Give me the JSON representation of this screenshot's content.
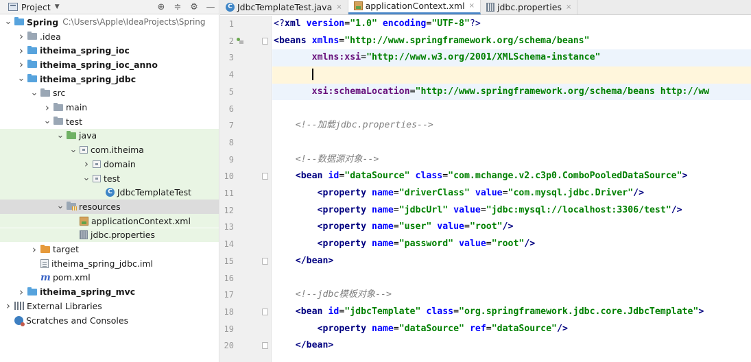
{
  "project_panel": {
    "title": "Project",
    "tree": [
      {
        "label": "Spring",
        "path": "C:\\Users\\Apple\\IdeaProjects\\Spring",
        "bold": true,
        "indent": 0,
        "arrow": "down",
        "icon": "folder-blue"
      },
      {
        "label": ".idea",
        "bold": false,
        "indent": 1,
        "arrow": "right",
        "icon": "folder-gray"
      },
      {
        "label": "itheima_spring_ioc",
        "bold": true,
        "indent": 1,
        "arrow": "right",
        "icon": "folder-blue"
      },
      {
        "label": "itheima_spring_ioc_anno",
        "bold": true,
        "indent": 1,
        "arrow": "right",
        "icon": "folder-blue"
      },
      {
        "label": "itheima_spring_jdbc",
        "bold": true,
        "indent": 1,
        "arrow": "down",
        "icon": "folder-blue"
      },
      {
        "label": "src",
        "bold": false,
        "indent": 2,
        "arrow": "down",
        "icon": "folder-gray"
      },
      {
        "label": "main",
        "bold": false,
        "indent": 3,
        "arrow": "right",
        "icon": "folder-gray"
      },
      {
        "label": "test",
        "bold": false,
        "indent": 3,
        "arrow": "down",
        "icon": "folder-gray"
      },
      {
        "label": "java",
        "bold": false,
        "indent": 4,
        "arrow": "down",
        "icon": "folder-green",
        "highlight": "green"
      },
      {
        "label": "com.itheima",
        "bold": false,
        "indent": 5,
        "arrow": "down",
        "icon": "package",
        "highlight": "green"
      },
      {
        "label": "domain",
        "bold": false,
        "indent": 6,
        "arrow": "right",
        "icon": "package",
        "highlight": "green"
      },
      {
        "label": "test",
        "bold": false,
        "indent": 6,
        "arrow": "down",
        "icon": "package",
        "highlight": "green"
      },
      {
        "label": "JdbcTemplateTest",
        "bold": false,
        "indent": 7,
        "arrow": "none",
        "icon": "class",
        "highlight": "green"
      },
      {
        "label": "resources",
        "bold": false,
        "indent": 4,
        "arrow": "down",
        "icon": "folder-resources",
        "highlight": "gray"
      },
      {
        "label": "applicationContext.xml",
        "bold": false,
        "indent": 5,
        "arrow": "none",
        "icon": "xml",
        "highlight": "green"
      },
      {
        "label": "jdbc.properties",
        "bold": false,
        "indent": 5,
        "arrow": "none",
        "icon": "properties",
        "highlight": "green"
      },
      {
        "label": "target",
        "bold": false,
        "indent": 2,
        "arrow": "right",
        "icon": "folder-orange"
      },
      {
        "label": "itheima_spring_jdbc.iml",
        "bold": false,
        "indent": 2,
        "arrow": "none",
        "icon": "iml"
      },
      {
        "label": "pom.xml",
        "bold": false,
        "indent": 2,
        "arrow": "none",
        "icon": "maven"
      },
      {
        "label": "itheima_spring_mvc",
        "bold": true,
        "indent": 1,
        "arrow": "right",
        "icon": "folder-blue"
      },
      {
        "label": "External Libraries",
        "bold": false,
        "indent": 0,
        "arrow": "right",
        "icon": "library"
      },
      {
        "label": "Scratches and Consoles",
        "bold": false,
        "indent": 0,
        "arrow": "none",
        "icon": "scratch"
      }
    ]
  },
  "tabs": [
    {
      "label": "JdbcTemplateTest.java",
      "icon": "class",
      "active": false
    },
    {
      "label": "applicationContext.xml",
      "icon": "xml",
      "active": true
    },
    {
      "label": "jdbc.properties",
      "icon": "properties",
      "active": false
    }
  ],
  "editor": {
    "lines": [
      {
        "num": "1",
        "tokens": [
          [
            "pi",
            "<?"
          ],
          [
            "tag",
            "xml "
          ],
          [
            "attr",
            "version"
          ],
          [
            "plain",
            "="
          ],
          [
            "str",
            "\"1.0\" "
          ],
          [
            "attr",
            "encoding"
          ],
          [
            "plain",
            "="
          ],
          [
            "str",
            "\"UTF-8\""
          ],
          [
            "pi",
            "?>"
          ]
        ],
        "indent": 0
      },
      {
        "num": "2",
        "tokens": [
          [
            "tag",
            "<beans "
          ],
          [
            "attr",
            "xmlns"
          ],
          [
            "plain",
            "="
          ],
          [
            "str",
            "\"http://www.springframework.org/schema/beans\""
          ]
        ],
        "indent": 0,
        "fold": true,
        "bean_icon": true
      },
      {
        "num": "3",
        "tokens": [
          [
            "ns",
            "xmlns:xsi"
          ],
          [
            "plain",
            "="
          ],
          [
            "str",
            "\"http://www.w3.org/2001/XMLSchema-instance\""
          ]
        ],
        "indent": 7,
        "highlight": "sel"
      },
      {
        "num": "4",
        "tokens": [],
        "indent": 7,
        "caret": true,
        "highlight": "hl"
      },
      {
        "num": "5",
        "tokens": [
          [
            "ns",
            "xsi:schemaLocation"
          ],
          [
            "plain",
            "="
          ],
          [
            "str",
            "\"http://www.springframework.org/schema/beans http://ww"
          ]
        ],
        "indent": 7,
        "highlight": "sel"
      },
      {
        "num": "6",
        "tokens": [],
        "indent": 0
      },
      {
        "num": "7",
        "tokens": [
          [
            "com",
            "<!--加载jdbc.properties-->"
          ]
        ],
        "indent": 4
      },
      {
        "num": "8",
        "tokens": [],
        "indent": 0
      },
      {
        "num": "9",
        "tokens": [
          [
            "com",
            "<!--数据源对象-->"
          ]
        ],
        "indent": 4
      },
      {
        "num": "10",
        "tokens": [
          [
            "tag",
            "<bean "
          ],
          [
            "attr",
            "id"
          ],
          [
            "plain",
            "="
          ],
          [
            "str",
            "\"dataSource\" "
          ],
          [
            "attr",
            "class"
          ],
          [
            "plain",
            "="
          ],
          [
            "str",
            "\"com.mchange.v2.c3p0.ComboPooledDataSource\""
          ],
          [
            "tag",
            ">"
          ]
        ],
        "indent": 4,
        "fold": true
      },
      {
        "num": "11",
        "tokens": [
          [
            "tag",
            "<property "
          ],
          [
            "attr",
            "name"
          ],
          [
            "plain",
            "="
          ],
          [
            "str",
            "\"driverClass\" "
          ],
          [
            "attr",
            "value"
          ],
          [
            "plain",
            "="
          ],
          [
            "str",
            "\"com.mysql.jdbc.Driver\""
          ],
          [
            "tag",
            "/>"
          ]
        ],
        "indent": 8
      },
      {
        "num": "12",
        "tokens": [
          [
            "tag",
            "<property "
          ],
          [
            "attr",
            "name"
          ],
          [
            "plain",
            "="
          ],
          [
            "str",
            "\"jdbcUrl\" "
          ],
          [
            "attr",
            "value"
          ],
          [
            "plain",
            "="
          ],
          [
            "str",
            "\"jdbc:mysql://localhost:3306/test\""
          ],
          [
            "tag",
            "/>"
          ]
        ],
        "indent": 8
      },
      {
        "num": "13",
        "tokens": [
          [
            "tag",
            "<property "
          ],
          [
            "attr",
            "name"
          ],
          [
            "plain",
            "="
          ],
          [
            "str",
            "\"user\" "
          ],
          [
            "attr",
            "value"
          ],
          [
            "plain",
            "="
          ],
          [
            "str",
            "\"root\""
          ],
          [
            "tag",
            "/>"
          ]
        ],
        "indent": 8
      },
      {
        "num": "14",
        "tokens": [
          [
            "tag",
            "<property "
          ],
          [
            "attr",
            "name"
          ],
          [
            "plain",
            "="
          ],
          [
            "str",
            "\"password\" "
          ],
          [
            "attr",
            "value"
          ],
          [
            "plain",
            "="
          ],
          [
            "str",
            "\"root\""
          ],
          [
            "tag",
            "/>"
          ]
        ],
        "indent": 8
      },
      {
        "num": "15",
        "tokens": [
          [
            "tag",
            "</bean>"
          ]
        ],
        "indent": 4,
        "fold": true
      },
      {
        "num": "16",
        "tokens": [],
        "indent": 0
      },
      {
        "num": "17",
        "tokens": [
          [
            "com",
            "<!--jdbc模板对象-->"
          ]
        ],
        "indent": 4
      },
      {
        "num": "18",
        "tokens": [
          [
            "tag",
            "<bean "
          ],
          [
            "attr",
            "id"
          ],
          [
            "plain",
            "="
          ],
          [
            "str",
            "\"jdbcTemplate\" "
          ],
          [
            "attr",
            "class"
          ],
          [
            "plain",
            "="
          ],
          [
            "str",
            "\"org.springframework.jdbc.core.JdbcTemplate\""
          ],
          [
            "tag",
            ">"
          ]
        ],
        "indent": 4,
        "fold": true
      },
      {
        "num": "19",
        "tokens": [
          [
            "tag",
            "<property "
          ],
          [
            "attr",
            "name"
          ],
          [
            "plain",
            "="
          ],
          [
            "str",
            "\"dataSource\" "
          ],
          [
            "attr",
            "ref"
          ],
          [
            "plain",
            "="
          ],
          [
            "str",
            "\"dataSource\""
          ],
          [
            "tag",
            "/>"
          ]
        ],
        "indent": 8
      },
      {
        "num": "20",
        "tokens": [
          [
            "tag",
            "</bean>"
          ]
        ],
        "indent": 4,
        "fold": true
      }
    ]
  }
}
